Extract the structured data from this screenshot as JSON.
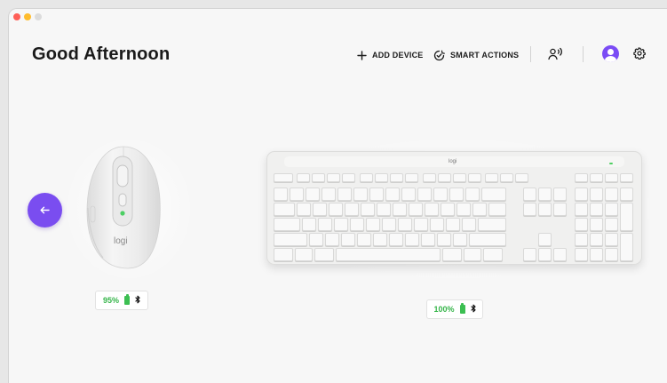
{
  "window": {
    "traffic_lights": [
      "#fe5f57",
      "#febc2e",
      "#dcdcdc"
    ]
  },
  "header": {
    "greeting": "Good Afternoon",
    "add_device_label": "ADD DEVICE",
    "smart_actions_label": "SMART ACTIONS",
    "icons": {
      "add": "plus-icon",
      "smart_actions": "smart-actions-icon",
      "voice": "voice-icon",
      "account": "avatar-icon",
      "settings": "gear-icon"
    }
  },
  "navigation": {
    "back_icon": "arrow-left-icon",
    "accent_color": "#7a4df0"
  },
  "devices": [
    {
      "kind": "mouse",
      "brand_text": "logi",
      "battery": "95%",
      "battery_color": "#36b54a",
      "connection_icon": "bluetooth-icon"
    },
    {
      "kind": "keyboard",
      "brand_text": "logi",
      "battery": "100%",
      "battery_color": "#36b54a",
      "connection_icon": "bluetooth-icon"
    }
  ]
}
